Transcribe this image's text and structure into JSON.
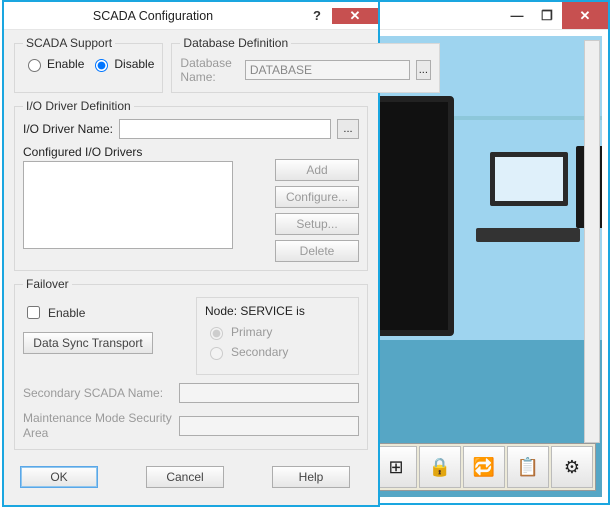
{
  "bgWindow": {
    "toolIcons": [
      "⊞",
      "🔒",
      "🔁",
      "📋",
      "⚙"
    ]
  },
  "dialog": {
    "title": "SCADA Configuration",
    "support": {
      "legend": "SCADA Support",
      "enable": "Enable",
      "disable": "Disable",
      "selected": "disable"
    },
    "db": {
      "legend": "Database Definition",
      "label": "Database Name:",
      "value": "DATABASE"
    },
    "io": {
      "legend": "I/O Driver Definition",
      "nameLabel": "I/O Driver Name:",
      "nameValue": "",
      "listLabel": "Configured I/O Drivers",
      "buttons": {
        "add": "Add",
        "configure": "Configure...",
        "setup": "Setup...",
        "delete": "Delete"
      }
    },
    "failover": {
      "legend": "Failover",
      "enable": "Enable",
      "dataSync": "Data Sync Transport",
      "nodeTitlePrefix": "Node: ",
      "nodeName": "SERVICE",
      "nodeTitleSuffix": " is",
      "primary": "Primary",
      "secondary": "Secondary",
      "selectedNode": "primary",
      "secScadaLabel": "Secondary SCADA Name:",
      "secScadaValue": "",
      "maintLabel": "Maintenance Mode Security Area",
      "maintValue": ""
    },
    "buttons": {
      "ok": "OK",
      "cancel": "Cancel",
      "help": "Help"
    }
  },
  "glyphs": {
    "help": "?",
    "close": "✕",
    "min": "—",
    "restore": "❐",
    "ellipsis": "..."
  }
}
